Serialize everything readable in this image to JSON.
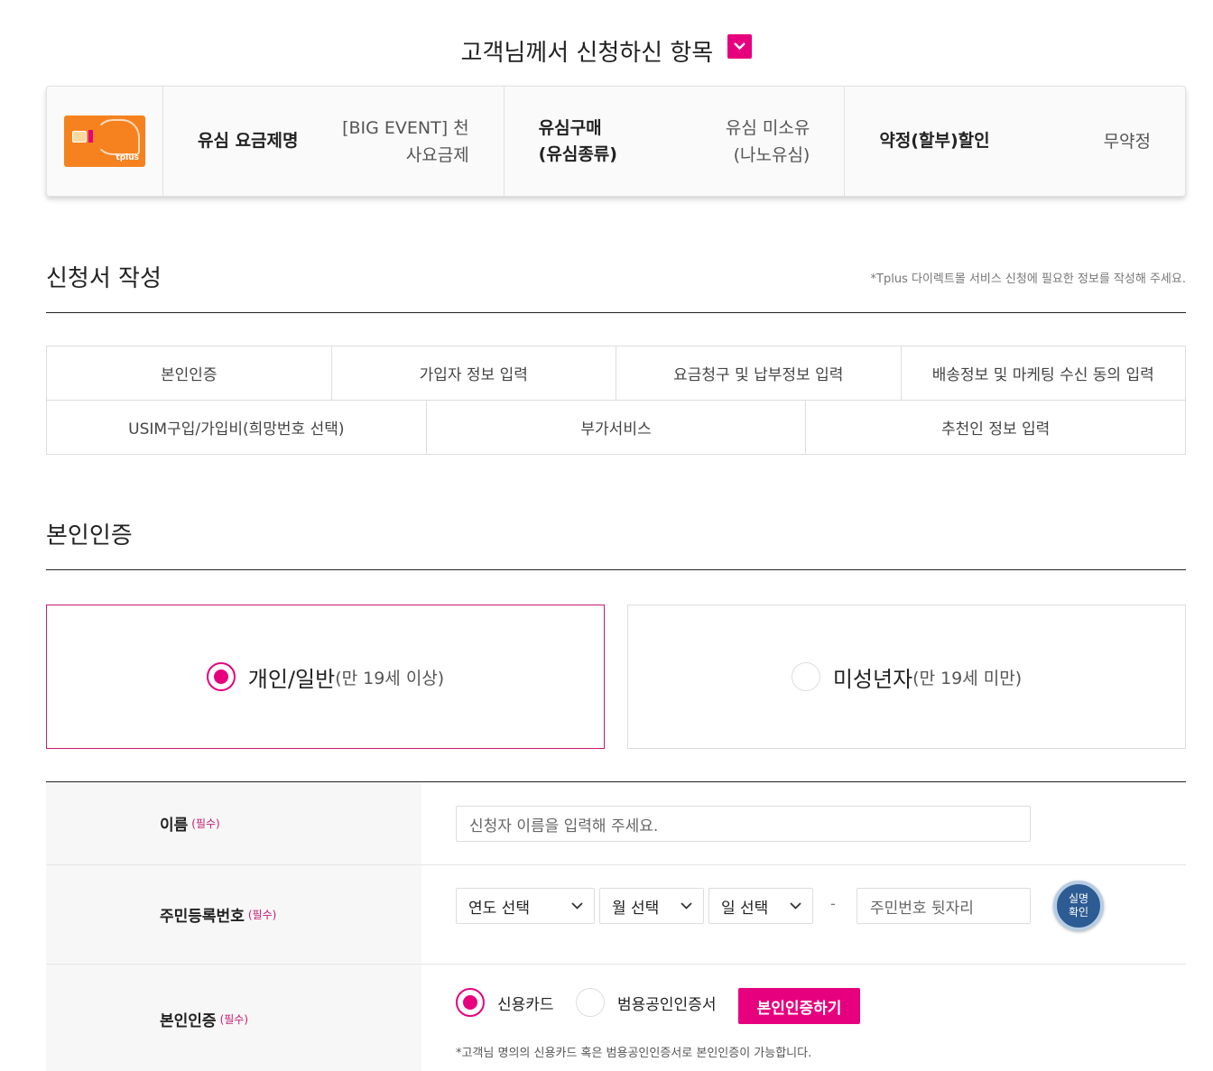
{
  "header": {
    "title": "고객님께서 신청하신 항목"
  },
  "summary": {
    "plan_label": "유심 요금제명",
    "plan_value_1": "[BIG EVENT] 천",
    "plan_value_2": "사요금제",
    "usim_label_1": "유심구매",
    "usim_label_2": "(유심종류)",
    "usim_value_1": "유심 미소유",
    "usim_value_2": "(나노유심)",
    "contract_label": "약정(할부)할인",
    "contract_value": "무약정",
    "card_brand": "tplus"
  },
  "application": {
    "title": "신청서 작성",
    "note": "*Tplus 다이렉트몰 서비스 신청에 필요한 정보를 작성해 주세요.",
    "steps_row1": [
      "본인인증",
      "가입자 정보 입력",
      "요금청구 및 납부정보 입력",
      "배송정보 및 마케팅 수신 동의 입력"
    ],
    "steps_row2": [
      "USIM구입/가입비(희망번호 선택)",
      "부가서비스",
      "추천인 정보 입력"
    ]
  },
  "identity": {
    "title": "본인인증",
    "adult_main": "개인/일반",
    "adult_sub": "(만 19세 이상)",
    "minor_main": "미성년자",
    "minor_sub": "(만 19세 미만)",
    "selected_type": "adult"
  },
  "form": {
    "required": "(필수)",
    "name_label": "이름",
    "name_placeholder": "신청자 이름을 입력해 주세요.",
    "rrn_label": "주민등록번호",
    "year_select": "연도 선택",
    "month_select": "월 선택",
    "day_select": "일 선택",
    "dash": "-",
    "rrn_back_placeholder": "주민번호 뒷자리",
    "verify_name_1": "실명",
    "verify_name_2": "확인",
    "auth_label": "본인인증",
    "auth_option_card": "신용카드",
    "auth_option_cert": "범용공인인증서",
    "auth_button": "본인인증하기",
    "auth_note": "*고객님 명의의 신용카드 혹은 범용공인인증서로 본인인증이 가능합니다.",
    "auth_selected": "card"
  },
  "colors": {
    "accent": "#e6007e",
    "selected_border": "#c41a73",
    "verify_button": "#2d5b93",
    "usim_card": "#f5821f"
  }
}
